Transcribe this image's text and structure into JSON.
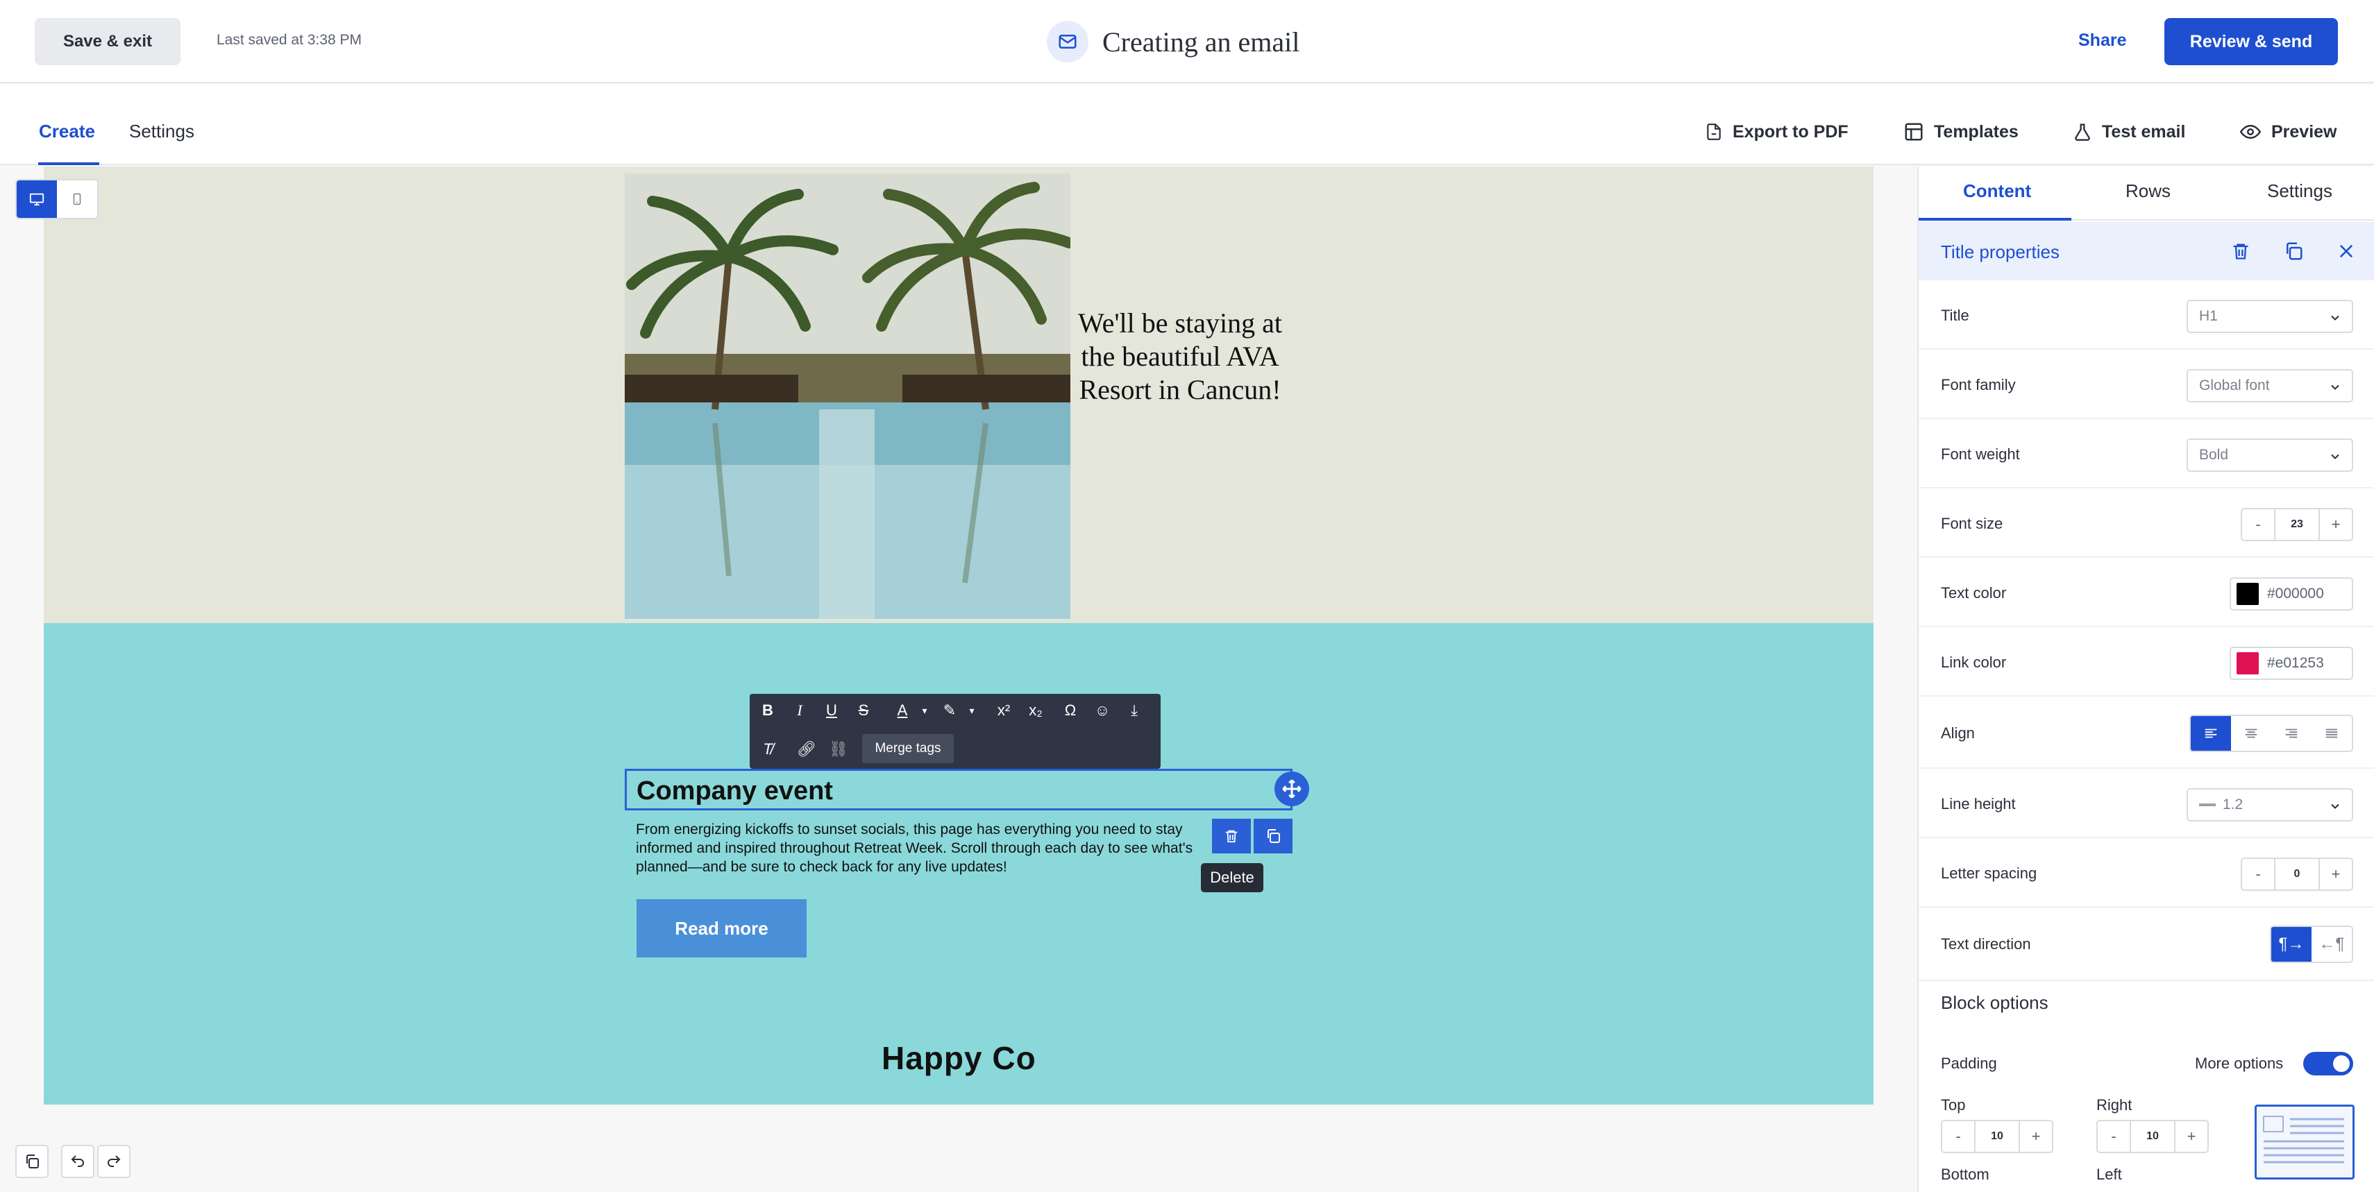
{
  "header": {
    "save_exit_label": "Save & exit",
    "last_saved": "Last saved at 3:38 PM",
    "title": "Creating an email",
    "share_label": "Share",
    "review_send_label": "Review & send"
  },
  "subnav": {
    "tabs": [
      {
        "label": "Create",
        "active": true
      },
      {
        "label": "Settings",
        "active": false
      }
    ],
    "actions": {
      "export_pdf": "Export to PDF",
      "templates": "Templates",
      "test_email": "Test email",
      "preview": "Preview"
    }
  },
  "email": {
    "hero_text": "We'll be staying at the beautiful AVA Resort in Cancun!",
    "title": "Company event",
    "body": "From energizing kickoffs to sunset socials, this page has everything you need to stay informed and inspired throughout Retreat Week. Scroll through each day to see what's planned—and be sure to check back for any live updates!",
    "button_label": "Read more",
    "brand": "Happy Co",
    "hero_bg": "#e5e6da",
    "event_bg": "#8ad8da"
  },
  "editor": {
    "merge_tags_label": "Merge tags",
    "delete_tooltip": "Delete"
  },
  "panel": {
    "tabs": [
      {
        "label": "Content",
        "active": true
      },
      {
        "label": "Rows",
        "active": false
      },
      {
        "label": "Settings",
        "active": false
      }
    ],
    "header_label": "Title properties",
    "rows": {
      "title": {
        "label": "Title",
        "value": "H1"
      },
      "font_family": {
        "label": "Font family",
        "value": "Global font"
      },
      "font_weight": {
        "label": "Font weight",
        "value": "Bold"
      },
      "font_size": {
        "label": "Font size",
        "value": "23"
      },
      "text_color": {
        "label": "Text color",
        "value": "#000000"
      },
      "link_color": {
        "label": "Link color",
        "value": "#e01253"
      },
      "align": {
        "label": "Align",
        "selected": "left"
      },
      "line_height": {
        "label": "Line height",
        "value": "1.2"
      },
      "letter_spacing": {
        "label": "Letter spacing",
        "value": "0"
      },
      "text_direction": {
        "label": "Text direction",
        "selected": "ltr"
      }
    },
    "block_options": {
      "heading": "Block options",
      "padding_label": "Padding",
      "more_options_label": "More options",
      "more_options_on": true,
      "top_label": "Top",
      "top_value": "10",
      "right_label": "Right",
      "right_value": "10",
      "bottom_label": "Bottom",
      "left_label": "Left"
    }
  },
  "colors": {
    "accent": "#1e4fd1",
    "selection": "#2a5fd6",
    "button": "#4a90d9"
  }
}
